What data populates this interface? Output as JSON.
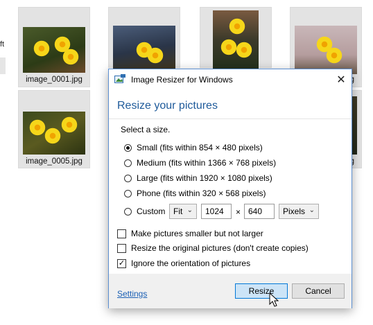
{
  "sidebar": {
    "partial_text": "ft"
  },
  "thumbnails": [
    {
      "filename": "image_0001.jpg"
    },
    {
      "filename": ""
    },
    {
      "filename": ""
    },
    {
      "filename": "g"
    },
    {
      "filename": "image_0005.jpg"
    },
    {
      "filename": "g"
    }
  ],
  "dialog": {
    "title": "Image Resizer for Windows",
    "close_glyph": "✕",
    "heading": "Resize your pictures",
    "prompt": "Select a size.",
    "sizes": [
      {
        "label": "Small (fits within 854 × 480 pixels)",
        "selected": true
      },
      {
        "label": "Medium (fits within 1366 × 768 pixels)",
        "selected": false
      },
      {
        "label": "Large (fits within 1920 × 1080 pixels)",
        "selected": false
      },
      {
        "label": "Phone (fits within 320 × 568 pixels)",
        "selected": false
      },
      {
        "label": "Custom",
        "selected": false
      }
    ],
    "custom": {
      "fit_value": "Fit",
      "width_value": "1024",
      "times_glyph": "×",
      "height_value": "640",
      "unit_value": "Pixels",
      "caret_glyph": "⌄"
    },
    "options": [
      {
        "label": "Make pictures smaller but not larger",
        "checked": false
      },
      {
        "label": "Resize the original pictures (don't create copies)",
        "checked": false
      },
      {
        "label": "Ignore the orientation of pictures",
        "checked": true
      }
    ],
    "check_glyph": "✓",
    "settings_link": "Settings",
    "resize_button": "Resize",
    "cancel_button": "Cancel"
  },
  "colors": {
    "accent": "#0078d7",
    "heading": "#1e5a9a",
    "link": "#1a5fb4"
  }
}
